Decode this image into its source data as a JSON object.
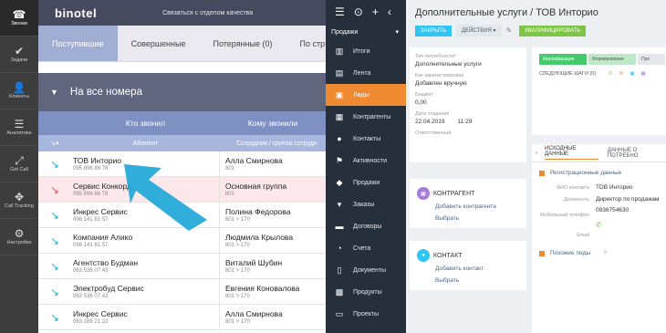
{
  "sidebar": [
    {
      "label": "Звонки",
      "icon": "phone-icon",
      "active": true
    },
    {
      "label": "Задачи",
      "icon": "check-icon"
    },
    {
      "label": "Клиенты",
      "icon": "user-icon"
    },
    {
      "label": "Аналитика",
      "icon": "chart-icon"
    },
    {
      "label": "Get Call",
      "icon": "getcall-icon"
    },
    {
      "label": "Call Tracking",
      "icon": "tracking-icon"
    },
    {
      "label": "Настройки",
      "icon": "gear-icon"
    }
  ],
  "binotel": {
    "logo": "binotel",
    "quality_link": "Связаться с отделом качества",
    "tabs": [
      "Поступившие",
      "Совершенные",
      "Потерянные (0)",
      "По стр"
    ],
    "number_filter": "На все номера",
    "col_caller": "Кто звонил",
    "col_callee": "Кому звонили",
    "sub_caller": "Абонент",
    "sub_callee": "Сотрудник / группа сотрудн",
    "rows": [
      {
        "name": "ТОВ Инторио",
        "phone": "095 896 86 78",
        "callee": "Алла Смирнова",
        "callee_sub": "801",
        "missed": false
      },
      {
        "name": "Сервис Конкорд",
        "phone": "095 896 86 78",
        "callee": "Основная группа",
        "callee_sub": "801",
        "missed": true
      },
      {
        "name": "Инкрес Сервис",
        "phone": "096 141 81 57",
        "callee": "Полина Федорова",
        "callee_sub": "801 > 170",
        "missed": false
      },
      {
        "name": "Компания Алико",
        "phone": "096 141 81 57",
        "callee": "Людмила Крылова",
        "callee_sub": "801 > 170",
        "missed": false
      },
      {
        "name": "Агентство Будман",
        "phone": "063 536 07 43",
        "callee": "Виталий Шубин",
        "callee_sub": "801 > 170",
        "missed": false
      },
      {
        "name": "Электробуд Сервис",
        "phone": "063 536 07 43",
        "callee": "Евгения Коновалова",
        "callee_sub": "801 > 170",
        "missed": false
      },
      {
        "name": "Инкрес Сервис",
        "phone": "063 289 21 22",
        "callee": "Алла Смирнова",
        "callee_sub": "801 > 170",
        "missed": false
      }
    ]
  },
  "crm_menu": {
    "selector": "Продажи",
    "items": [
      {
        "label": "Итоги",
        "icon": "bar-chart-icon"
      },
      {
        "label": "Лента",
        "icon": "feed-icon"
      },
      {
        "label": "Лиды",
        "icon": "leads-icon",
        "active": true
      },
      {
        "label": "Контрагенты",
        "icon": "company-icon"
      },
      {
        "label": "Контакты",
        "icon": "contact-icon"
      },
      {
        "label": "Активности",
        "icon": "flag-icon"
      },
      {
        "label": "Продажи",
        "icon": "sales-icon"
      },
      {
        "label": "Заказы",
        "icon": "cart-icon"
      },
      {
        "label": "Договоры",
        "icon": "contract-icon"
      },
      {
        "label": "Счета",
        "icon": "invoice-icon"
      },
      {
        "label": "Документы",
        "icon": "documents-icon"
      },
      {
        "label": "Продукты",
        "icon": "products-icon"
      },
      {
        "label": "Проекты",
        "icon": "projects-icon"
      }
    ]
  },
  "crm": {
    "title": "Дополнительные услуги / ТОВ Инторио",
    "btn_close": "ЗАКРЫТЬ",
    "btn_actions": "ДЕЙСТВИЯ",
    "btn_qualify": "КВАЛИФИЦИРОВАТЬ",
    "fields": [
      {
        "label": "Тип потребности*",
        "value": "Дополнительные услуги"
      },
      {
        "label": "Как зарегистрирован",
        "value": "Добавлен вручную"
      },
      {
        "label": "Бюджет",
        "value": "0,00"
      },
      {
        "label": "Дата создания",
        "value": "22.04.2019",
        "extra": "11:29"
      },
      {
        "label": "Ответственный",
        "value": ""
      }
    ],
    "stages": [
      "Квалификация",
      "Формирование",
      "Пре"
    ],
    "next_steps": "СЛЕДУЮЩИЕ ШАГИ (0)",
    "counterparty": {
      "title": "КОНТРАГЕНТ",
      "add": "Добавить контрагента",
      "choose": "Выбрать"
    },
    "contact": {
      "title": "КОНТАКТ",
      "add": "Добавить контакт",
      "choose": "Выбрать"
    },
    "tabs": [
      "ИСХОДНЫЕ ДАННЫЕ",
      "ДАННЫЕ О ПОТРЕБНО"
    ],
    "section_reg": "Регистрационные данные",
    "reg_fields": [
      {
        "label": "ФИО контакта",
        "value": "ТОВ Инторио"
      },
      {
        "label": "Должность",
        "value": "Директор по продажам"
      },
      {
        "label": "Мобильный телефон",
        "value": "0936754630"
      },
      {
        "label": "Email",
        "value": ""
      }
    ],
    "similar": "Похожие лиды"
  }
}
